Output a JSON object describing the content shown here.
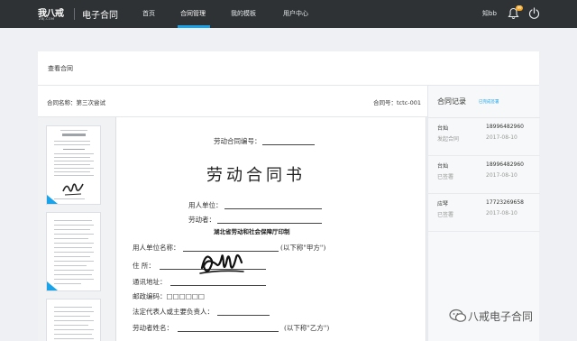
{
  "header": {
    "logo_text": "我八戒",
    "logo_sub": "ZBJ.COM",
    "app_title": "电子合同",
    "nav": [
      {
        "label": "首页"
      },
      {
        "label": "合同管理"
      },
      {
        "label": "我的模板"
      },
      {
        "label": "用户中心"
      }
    ],
    "active_nav": "合同管理",
    "username": "知bb",
    "notification_count": "99",
    "icons": [
      "bell-icon",
      "power-icon"
    ],
    "accent_color": "#1aa3e8",
    "bg_color": "#2f3235"
  },
  "main": {
    "card_title": "查看合同",
    "contract_name": "合同名称：第三次尝试",
    "contract_no": "合同号：tctc-001"
  },
  "document": {
    "no_label": "劳动合同编号：",
    "title": "劳动合同书",
    "employer_label": "用人单位：",
    "worker_label": "劳动者：",
    "publisher": "湖北省劳动和社会保障厅印制",
    "employer_name_label": "用人单位名称：",
    "party_a": "(以下称\"甲方\")",
    "address_label": "住 所：",
    "mail_address_label": "通讯地址：",
    "postcode_label": "邮政编码：□□□□□□",
    "legal_rep_label": "法定代表人或主要负责人：",
    "worker_name_label": "劳动者姓名：",
    "party_b": "(以下称\"乙方\")"
  },
  "records": {
    "title": "合同记录",
    "link": "已完成签署",
    "entries": [
      {
        "name": "台灿",
        "phone": "18996482960",
        "status": "发起合同",
        "date": "2017-08-10"
      },
      {
        "name": "台灿",
        "phone": "18996482960",
        "status": "已签署",
        "date": "2017-08-10"
      },
      {
        "name": "应琴",
        "phone": "17723269658",
        "status": "已签署",
        "date": "2017-08-10"
      }
    ]
  },
  "watermark": {
    "text": "八戒电子合同"
  }
}
